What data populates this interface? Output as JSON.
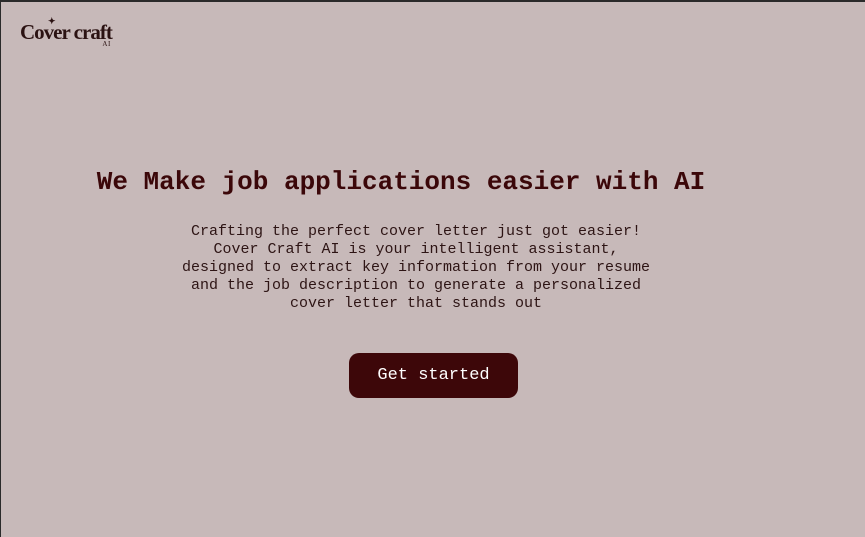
{
  "logo": {
    "name": "Cover craft",
    "sub": "AI",
    "star": "✦"
  },
  "hero": {
    "title": "We Make job applications easier with AI",
    "description_lines": [
      "Crafting the perfect cover letter just got easier!",
      "Cover Craft AI is your intelligent assistant,",
      "designed to extract key information from your resume",
      "and the job description to generate a personalized",
      "cover letter that stands out"
    ],
    "cta_label": "Get started"
  },
  "colors": {
    "background": "#c7b9b9",
    "accent": "#3d0709",
    "heading": "#3b0709",
    "button_text": "#ffffff"
  }
}
